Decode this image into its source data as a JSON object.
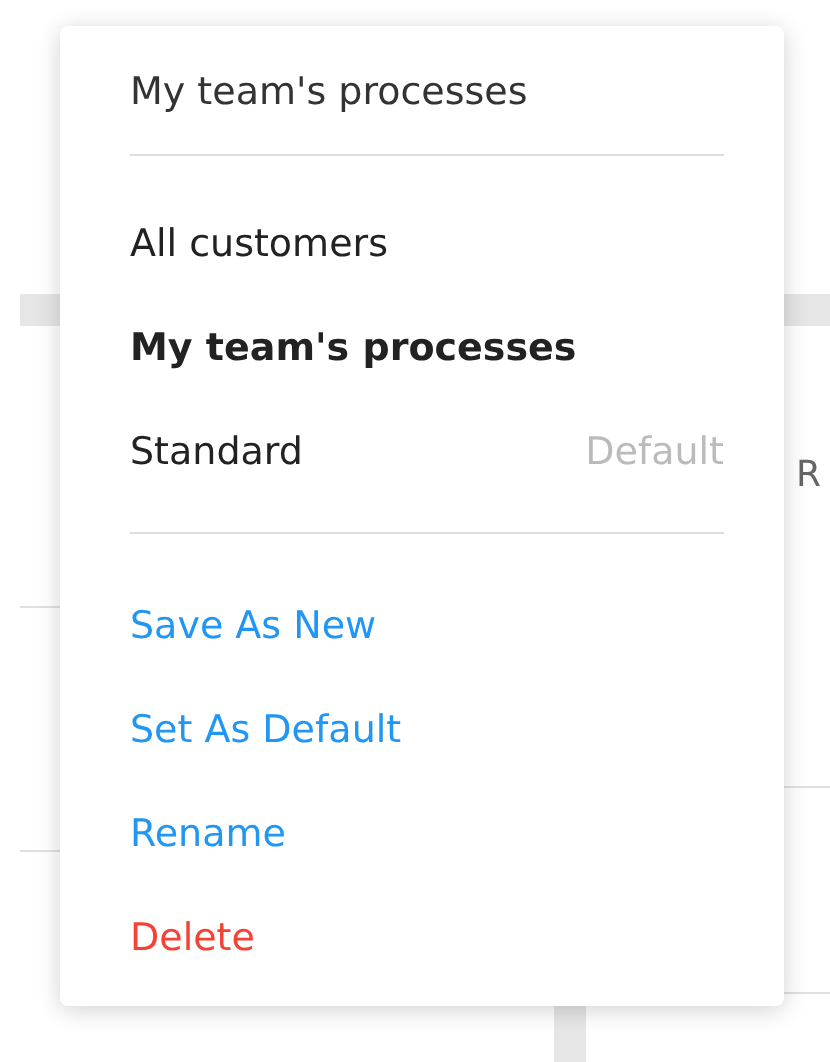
{
  "background_text": "R",
  "menu": {
    "title": "My team's processes",
    "views": [
      {
        "label": "All customers",
        "selected": false
      },
      {
        "label": "My team's processes",
        "selected": true
      },
      {
        "label": "Standard",
        "selected": false,
        "badge": "Default"
      }
    ],
    "actions": [
      {
        "label": "Save As New",
        "kind": "action"
      },
      {
        "label": "Set As Default",
        "kind": "action"
      },
      {
        "label": "Rename",
        "kind": "action"
      },
      {
        "label": "Delete",
        "kind": "danger"
      }
    ]
  }
}
